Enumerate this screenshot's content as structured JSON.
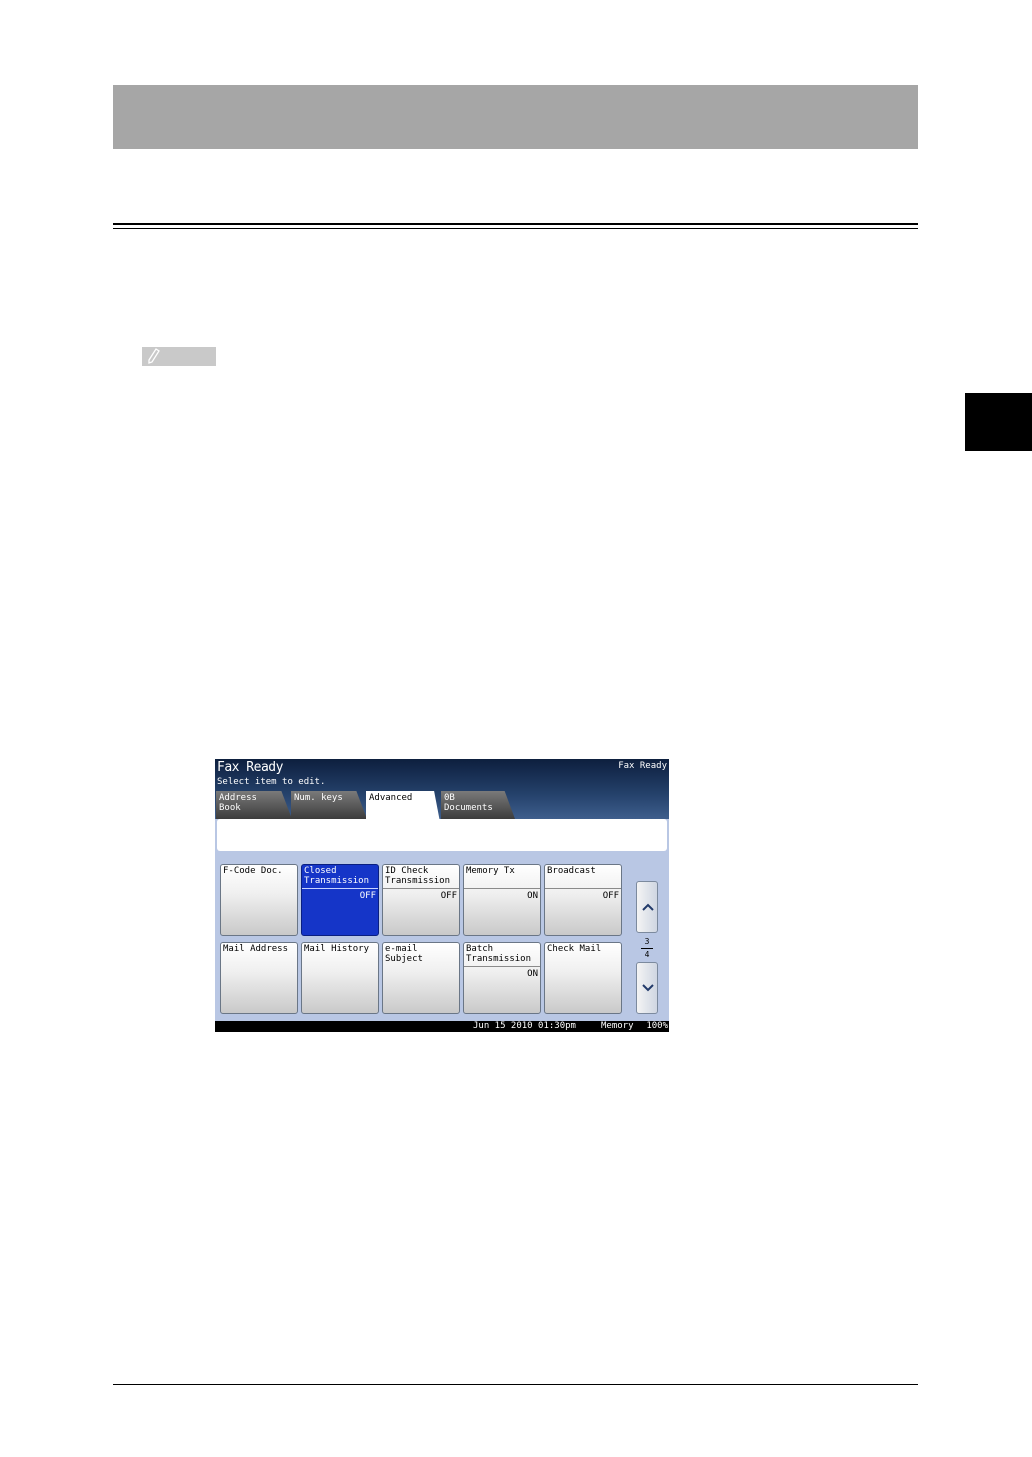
{
  "panel": {
    "title": "Fax Ready",
    "status_right": "Fax Ready",
    "subtitle": "Select item to edit.",
    "tabs": [
      {
        "label": "Address\nBook"
      },
      {
        "label": "Num. keys"
      },
      {
        "label": "Advanced"
      },
      {
        "label": "0B\nDocuments"
      }
    ],
    "keys": [
      {
        "label": "F-Code Doc.",
        "value": ""
      },
      {
        "label": "Closed\nTransmission",
        "value": "OFF"
      },
      {
        "label": "ID Check\nTransmission",
        "value": "OFF"
      },
      {
        "label": "Memory Tx",
        "value": "ON"
      },
      {
        "label": "Broadcast",
        "value": "OFF"
      },
      {
        "label": "Mail Address",
        "value": ""
      },
      {
        "label": "Mail History",
        "value": ""
      },
      {
        "label": "e-mail Subject",
        "value": ""
      },
      {
        "label": "Batch\nTransmission",
        "value": "ON"
      },
      {
        "label": "Check Mail",
        "value": ""
      }
    ],
    "page": {
      "current": "3",
      "total": "4"
    },
    "status_bar": {
      "datetime": "Jun 15 2010 01:30pm",
      "memory_label": "Memory",
      "memory_value": "100%"
    }
  }
}
